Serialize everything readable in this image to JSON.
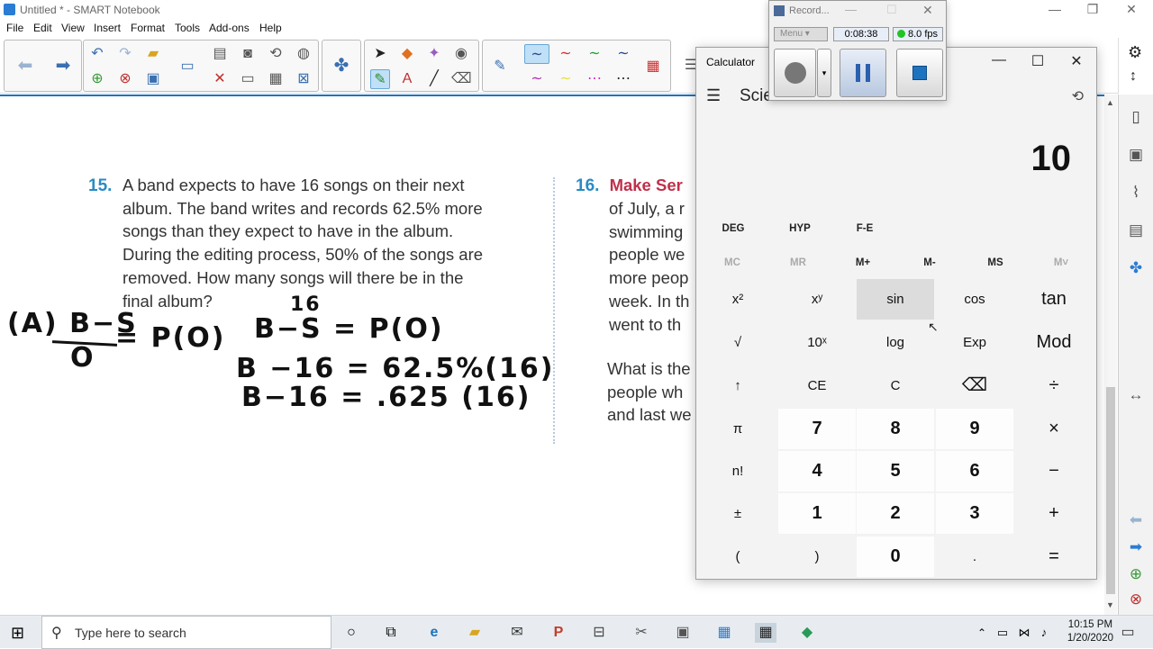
{
  "window": {
    "title": "Untitled * - SMART Notebook",
    "controls": [
      "—",
      "❐",
      "✕"
    ]
  },
  "menubar": [
    "File",
    "Edit",
    "View",
    "Insert",
    "Format",
    "Tools",
    "Add-ons",
    "Help"
  ],
  "problem15": {
    "number": "15.",
    "lines": [
      "A band expects to have 16 songs on their next",
      "album. The band writes and records 62.5% more",
      "songs than they expect to have in the album.",
      "During the editing process, 50% of the songs are",
      "removed. How many songs will there be in the",
      "final album?"
    ]
  },
  "problem16": {
    "number": "16.",
    "title": "Make Ser",
    "lines": [
      "of July, a r",
      "swimming",
      "people we",
      "more peop",
      "week. In th",
      "went to th"
    ],
    "lines2": [
      "What is the",
      "people wh",
      "and last we"
    ]
  },
  "handwriting": {
    "left_eq": "(A) B−S",
    "left_den": "O",
    "left_rhs": "= P(O)",
    "sup16": "16",
    "eq1": "B−S = P(O)",
    "eq2": "B −16 = 62.5%(16)",
    "eq3": "B−16 = .625 (16)"
  },
  "recorder": {
    "title": "Record...",
    "menu": "Menu",
    "time": "0:08:38",
    "fps": "8.0 fps",
    "status_color": "#22c322"
  },
  "calculator": {
    "title": "Calculator",
    "mode": "Scie",
    "display": "10",
    "tags": [
      "DEG",
      "HYP",
      "F-E"
    ],
    "memory": [
      "MC",
      "MR",
      "M+",
      "M-",
      "MS",
      "M˅"
    ],
    "memory_disabled": [
      true,
      true,
      false,
      false,
      false,
      true
    ],
    "rows": [
      [
        "x²",
        "xʸ",
        "sin",
        "cos",
        "tan"
      ],
      [
        "√",
        "10ˣ",
        "log",
        "Exp",
        "Mod"
      ],
      [
        "↑",
        "CE",
        "C",
        "⌫",
        "÷"
      ],
      [
        "π",
        "7",
        "8",
        "9",
        "×"
      ],
      [
        "n!",
        "4",
        "5",
        "6",
        "−"
      ],
      [
        "±",
        "1",
        "2",
        "3",
        "+"
      ],
      [
        "(",
        ")",
        "0",
        ".",
        "="
      ]
    ]
  },
  "taskbar": {
    "search_placeholder": "Type here to search",
    "time": "10:15 PM",
    "date": "1/20/2020"
  },
  "colors": {
    "accent": "#1e73be",
    "problem_number": "#2a8bc4",
    "problem16_title": "#c0304a"
  }
}
